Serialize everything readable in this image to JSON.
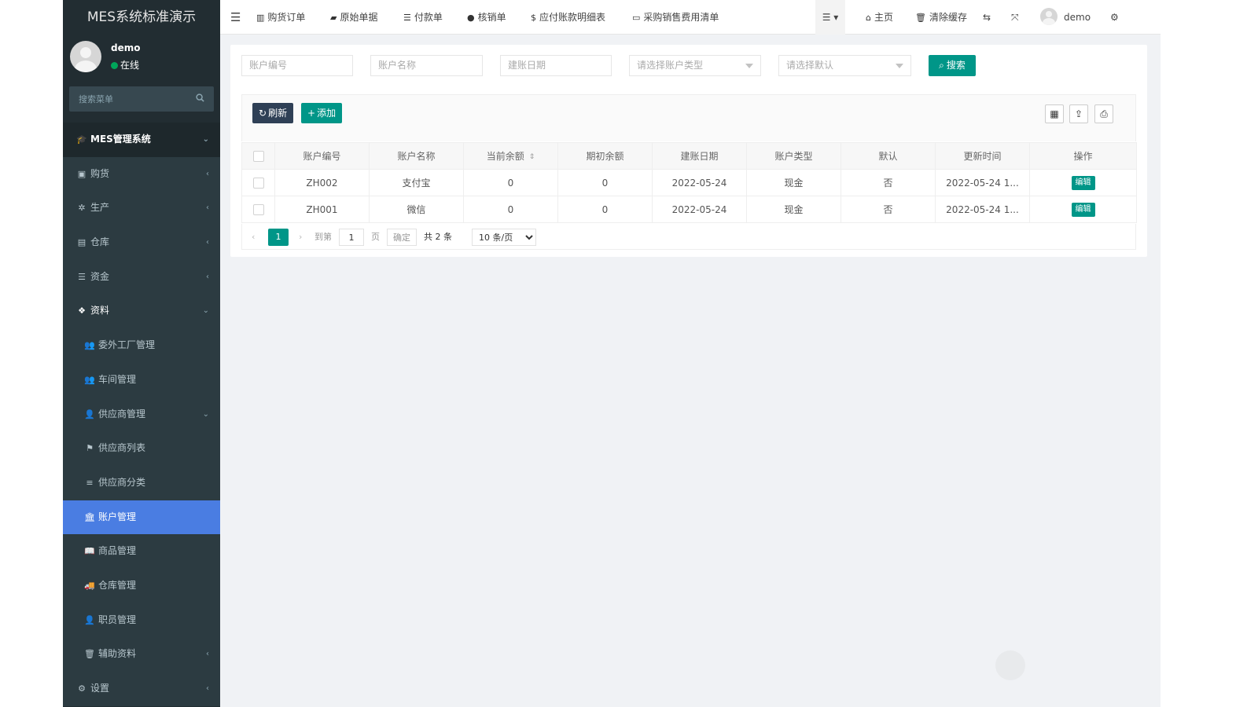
{
  "app": {
    "title": "MES系统标准演示"
  },
  "user": {
    "name": "demo",
    "status": "在线"
  },
  "sidebar": {
    "search_placeholder": "搜索菜单",
    "items": [
      {
        "label": "MES管理系统",
        "icon": "graduation-cap-icon",
        "arrow": "⌄"
      },
      {
        "label": "购货",
        "icon": "cart-icon",
        "arrow": "‹"
      },
      {
        "label": "生产",
        "icon": "production-icon",
        "arrow": "‹"
      },
      {
        "label": "仓库",
        "icon": "warehouse-icon",
        "arrow": "‹"
      },
      {
        "label": "资金",
        "icon": "database-icon",
        "arrow": "‹"
      },
      {
        "label": "资料",
        "icon": "cubes-icon",
        "arrow": "⌄"
      },
      {
        "label": "委外工厂管理",
        "icon": "user-plus-icon",
        "arrow": ""
      },
      {
        "label": "车间管理",
        "icon": "user-plus-icon",
        "arrow": ""
      },
      {
        "label": "供应商管理",
        "icon": "user-icon",
        "arrow": "⌄"
      },
      {
        "label": "供应商列表",
        "icon": "flag-icon",
        "arrow": ""
      },
      {
        "label": "供应商分类",
        "icon": "list-icon",
        "arrow": ""
      },
      {
        "label": "账户管理",
        "icon": "bank-icon",
        "arrow": ""
      },
      {
        "label": "商品管理",
        "icon": "book-icon",
        "arrow": ""
      },
      {
        "label": "仓库管理",
        "icon": "truck-icon",
        "arrow": ""
      },
      {
        "label": "职员管理",
        "icon": "user-icon",
        "arrow": ""
      },
      {
        "label": "辅助资料",
        "icon": "trash-icon",
        "arrow": "‹"
      },
      {
        "label": "设置",
        "icon": "cogs-icon",
        "arrow": "‹"
      }
    ]
  },
  "header": {
    "tabs": [
      {
        "label": "购货订单",
        "icon": "bar-chart-icon"
      },
      {
        "label": "原始单据",
        "icon": "book-icon"
      },
      {
        "label": "付款单",
        "icon": "database-icon"
      },
      {
        "label": "核销单",
        "icon": "apple-icon"
      },
      {
        "label": "应付账款明细表",
        "icon": "dollar-icon"
      },
      {
        "label": "采购销售费用清单",
        "icon": "card-icon"
      }
    ],
    "home": "主页",
    "clear_cache": "清除缓存",
    "username": "demo"
  },
  "filters": {
    "account_no": "账户编号",
    "account_name": "账户名称",
    "create_date": "建账日期",
    "account_type": "请选择账户类型",
    "default": "请选择默认",
    "search": "搜索"
  },
  "toolbar": {
    "refresh": "刷新",
    "add": "添加"
  },
  "table": {
    "columns": [
      "账户编号",
      "账户名称",
      "当前余额",
      "期初余额",
      "建账日期",
      "账户类型",
      "默认",
      "更新时间",
      "操作"
    ],
    "rows": [
      {
        "no": "ZH002",
        "name": "支付宝",
        "current": "0",
        "initial": "0",
        "date": "2022-05-24",
        "type": "现金",
        "default": "否",
        "updated": "2022-05-24 1...",
        "action": "编辑"
      },
      {
        "no": "ZH001",
        "name": "微信",
        "current": "0",
        "initial": "0",
        "date": "2022-05-24",
        "type": "现金",
        "default": "否",
        "updated": "2022-05-24 1...",
        "action": "编辑"
      }
    ]
  },
  "pager": {
    "current": "1",
    "goto": "到第",
    "page_input": "1",
    "page": "页",
    "confirm": "确定",
    "total": "共 2 条",
    "size_options": [
      "10 条/页"
    ]
  },
  "colors": {
    "sidebar": "#222d32",
    "accent": "#009688",
    "active": "#4a7de2",
    "dark_btn": "#2f4056"
  }
}
